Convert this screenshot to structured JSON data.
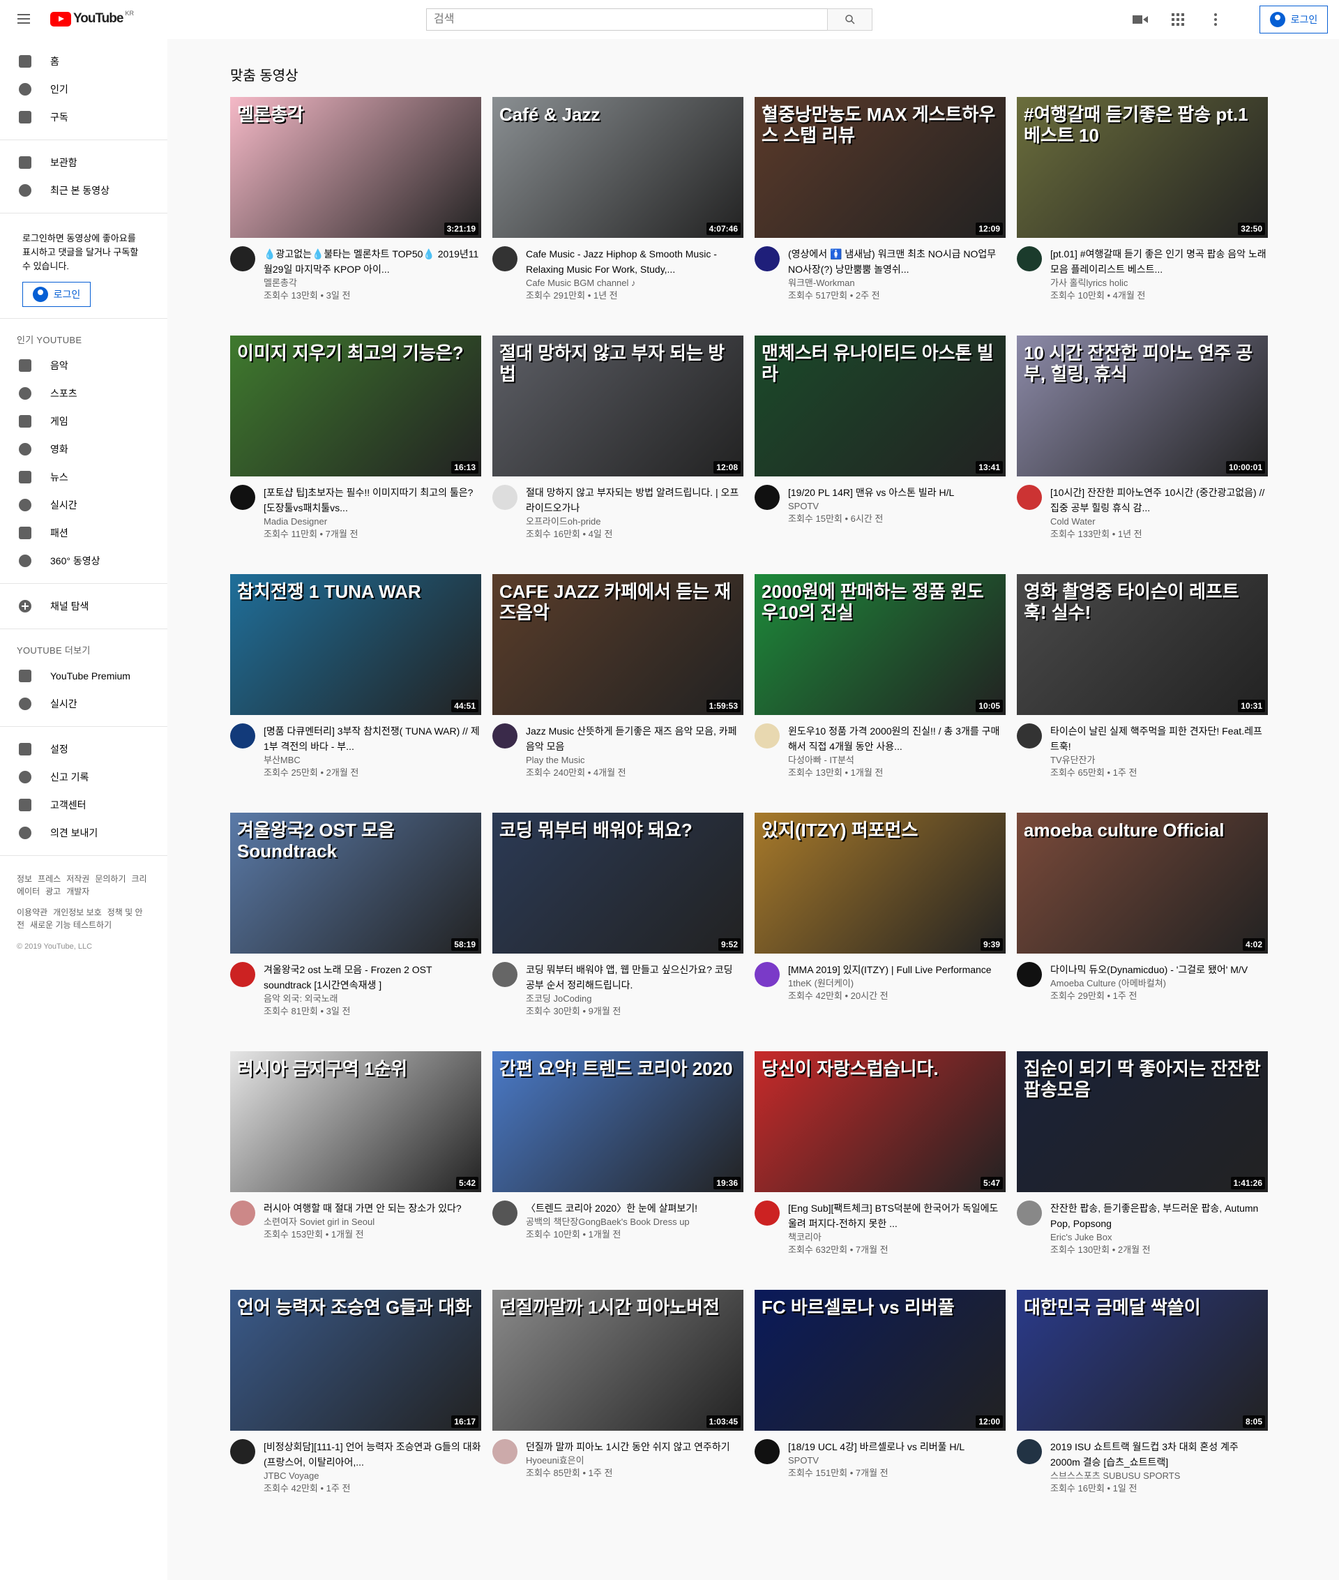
{
  "header": {
    "logo_text": "YouTube",
    "logo_region": "KR",
    "search_placeholder": "검색",
    "signin": "로그인",
    "icons": [
      "menu-icon",
      "video-camera-icon",
      "apps-icon",
      "more-vert-icon"
    ]
  },
  "sidebar": {
    "primary": [
      {
        "label": "홈",
        "icon": "home-icon"
      },
      {
        "label": "인기",
        "icon": "flame-icon"
      },
      {
        "label": "구독",
        "icon": "subscriptions-icon"
      }
    ],
    "library": [
      {
        "label": "보관함",
        "icon": "folder-icon"
      },
      {
        "label": "최근 본 동영상",
        "icon": "history-icon"
      }
    ],
    "note": "로그인하면 동영상에 좋아요를 표시하고 댓글을 달거나 구독할 수 있습니다.",
    "login": "로그인",
    "popular_title": "인기 YOUTUBE",
    "popular": [
      {
        "label": "음악",
        "icon": "music-icon"
      },
      {
        "label": "스포츠",
        "icon": "sports-icon"
      },
      {
        "label": "게임",
        "icon": "gaming-icon"
      },
      {
        "label": "영화",
        "icon": "movies-icon"
      },
      {
        "label": "뉴스",
        "icon": "news-icon"
      },
      {
        "label": "실시간",
        "icon": "live-icon"
      },
      {
        "label": "패션",
        "icon": "fashion-icon"
      },
      {
        "label": "360° 동영상",
        "icon": "vr-icon"
      }
    ],
    "browse": "채널 탐색",
    "more_title": "YOUTUBE 더보기",
    "more": [
      {
        "label": "YouTube Premium",
        "icon": "premium-icon"
      },
      {
        "label": "실시간",
        "icon": "broadcast-icon"
      }
    ],
    "settings": [
      {
        "label": "설정",
        "icon": "settings-icon"
      },
      {
        "label": "신고 기록",
        "icon": "flag-icon"
      },
      {
        "label": "고객센터",
        "icon": "help-icon"
      },
      {
        "label": "의견 보내기",
        "icon": "feedback-icon"
      }
    ],
    "footer1": [
      "정보",
      "프레스",
      "저작권",
      "문의하기",
      "크리에이터",
      "광고",
      "개발자"
    ],
    "footer2": [
      "이용약관",
      "개인정보 보호",
      "정책 및 안전",
      "새로운 기능 테스트하기"
    ],
    "copyright": "© 2019 YouTube, LLC"
  },
  "main": {
    "section_title": "맞춤 동영상"
  },
  "videos": [
    {
      "title": "💧광고없는💧불타는 멜론차트 TOP50💧 2019년11월29일 마지막주 KPOP 아이...",
      "channel": "멜론총각",
      "views": "조회수 13만회 • 3일 전",
      "duration": "3:21:19",
      "overlay": "멜론총각",
      "bg": "#f5b9c7",
      "av": "#222"
    },
    {
      "title": "Cafe Music - Jazz Hiphop & Smooth Music - Relaxing Music For Work, Study,...",
      "channel": "Cafe Music BGM channel ♪",
      "views": "조회수 291만회 • 1년 전",
      "duration": "4:07:46",
      "overlay": "Café & Jazz",
      "bg": "#8a8f92",
      "av": "#333"
    },
    {
      "title": "(영상에서 🚺 냄새남) 워크맨 최초 NO시급 NO업무 NO사장(?) 낭만뿜뿜 놀영쉬...",
      "channel": "워크맨-Workman",
      "views": "조회수 517만회 • 2주 전",
      "duration": "12:09",
      "overlay": "혈중낭만농도 MAX 게스트하우스 스탭 리뷰",
      "bg": "#5b3a2a",
      "av": "#1f1f7a"
    },
    {
      "title": "[pt.01] #여행갈때 듣기 좋은 인기 명곡 팝송 음악 노래 모음 플레이리스트 베스트...",
      "channel": "가사 홀릭lyrics holic",
      "views": "조회수 10만회 • 4개월 전",
      "duration": "32:50",
      "overlay": "#여행갈때 듣기좋은 팝송 pt.1 베스트 10",
      "bg": "#6b6e3c",
      "av": "#1b3b2c"
    },
    {
      "title": "[포토샵 팁]초보자는 필수!! 이미지따기 최고의 툴은? [도장툴vs패치툴vs...",
      "channel": "Madia Designer",
      "views": "조회수 11만회 • 7개월 전",
      "duration": "16:13",
      "overlay": "이미지 지우기 최고의 기능은?",
      "bg": "#3f7a2e",
      "av": "#111"
    },
    {
      "title": "절대 망하지 않고 부자되는 방법 알려드립니다. | 오프라이드오가나",
      "channel": "오프라이드oh-pride",
      "views": "조회수 16만회 • 4일 전",
      "duration": "12:08",
      "overlay": "절대 망하지 않고 부자 되는 방법",
      "bg": "#5d5f66",
      "av": "#ddd"
    },
    {
      "title": "[19/20 PL 14R] 맨유 vs 아스톤 빌라 H/L",
      "channel": "SPOTV",
      "views": "조회수 15만회 • 6시간 전",
      "duration": "13:41",
      "overlay": "맨체스터 유나이티드 아스톤 빌라",
      "bg": "#1b4a2a",
      "av": "#111"
    },
    {
      "title": "[10시간] 잔잔한 피아노연주 10시간 (중간광고없음) // 집중 공부 힐링 휴식 감...",
      "channel": "Cold Water",
      "views": "조회수 133만회 • 1년 전",
      "duration": "10:00:01",
      "overlay": "10 시간 잔잔한 피아노 연주 공부, 힐링, 휴식",
      "bg": "#8c8aa8",
      "av": "#c33"
    },
    {
      "title": "[명품 다큐멘터리] 3부작 참치전쟁( TUNA WAR) // 제1부 격전의 바다 - 부...",
      "channel": "부산MBC",
      "views": "조회수 25만회 • 2개월 전",
      "duration": "44:51",
      "overlay": "참치전쟁 1 TUNA WAR",
      "bg": "#1f6f9a",
      "av": "#123a7a"
    },
    {
      "title": "Jazz Music 산뜻하게 듣기좋은 재즈 음악 모음, 카페음악 모음",
      "channel": "Play the Music",
      "views": "조회수 240만회 • 4개월 전",
      "duration": "1:59:53",
      "overlay": "CAFE JAZZ 카페에서 듣는 재즈음악",
      "bg": "#5a3d2a",
      "av": "#3a2a4a"
    },
    {
      "title": "윈도우10 정품 가격 2000원의 진실!! / 총 3개를 구매해서 직접 4개월 동안 사용...",
      "channel": "다성아빠 - IT분석",
      "views": "조회수 13만회 • 1개월 전",
      "duration": "10:05",
      "overlay": "2000원에 판매하는 정품 윈도우10의 진실",
      "bg": "#1d8a3a",
      "av": "#e8d8b0"
    },
    {
      "title": "타이슨이 날린 실제 핵주먹을 피한 견자단! Feat.레프트훅!",
      "channel": "TV유단잔가",
      "views": "조회수 65만회 • 1주 전",
      "duration": "10:31",
      "overlay": "영화 촬영중 타이슨이 레프트훅! 실수!",
      "bg": "#4a4a4a",
      "av": "#333"
    },
    {
      "title": "겨울왕국2 ost 노래 모음 - Frozen 2 OST soundtrack [1시간연속재생 ]",
      "channel": "음악 외국: 외국노래",
      "views": "조회수 81만회 • 3일 전",
      "duration": "58:19",
      "overlay": "겨울왕국2 OST 모음 Soundtrack",
      "bg": "#5a7aa8",
      "av": "#c22"
    },
    {
      "title": "코딩 뭐부터 배워야 앱, 웹 만들고 싶으신가요? 코딩 공부 순서 정리해드립니다.",
      "channel": "조코딩 JoCoding",
      "views": "조회수 30만회 • 9개월 전",
      "duration": "9:52",
      "overlay": "코딩 뭐부터 배워야 돼요?",
      "bg": "#2b3a55",
      "av": "#666"
    },
    {
      "title": "[MMA 2019] 있지(ITZY) | Full Live Performance",
      "channel": "1theK (원더케이)",
      "views": "조회수 42만회 • 20시간 전",
      "duration": "9:39",
      "overlay": "있지(ITZY) 퍼포먼스",
      "bg": "#a87a2a",
      "av": "#7a3ac8"
    },
    {
      "title": "다이나믹 듀오(Dynamicduo) - '그걸로 됐어' M/V",
      "channel": "Amoeba Culture (아메바컬쳐)",
      "views": "조회수 29만회 • 1주 전",
      "duration": "4:02",
      "overlay": "amoeba culture Official",
      "bg": "#7a4a3a",
      "av": "#111"
    },
    {
      "title": "러시아 여행할 때 절대 가면 안 되는 장소가 있다?",
      "channel": "소련여자 Soviet girl in Seoul",
      "views": "조회수 153만회 • 1개월 전",
      "duration": "5:42",
      "overlay": "러시아 금지구역 1순위",
      "bg": "#e6e6e6",
      "av": "#c88"
    },
    {
      "title": "〈트렌드 코리아 2020〉한 눈에 살펴보기!",
      "channel": "공백의 책단장GongBaek's Book Dress up",
      "views": "조회수 10만회 • 1개월 전",
      "duration": "19:36",
      "overlay": "간편 요약! 트렌드 코리아 2020",
      "bg": "#4a7ac8",
      "av": "#555"
    },
    {
      "title": "[Eng Sub][팩트체크] BTS덕분에 한국어가 독일에도 울려 퍼지다-전하지 못한 ...",
      "channel": "책코리아",
      "views": "조회수 632만회 • 7개월 전",
      "duration": "5:47",
      "overlay": "당신이 자랑스럽습니다.",
      "bg": "#c82a2a",
      "av": "#c22"
    },
    {
      "title": "잔잔한 팝송, 듣기좋은팝송, 부드러운 팝송, Autumn Pop, Popsong",
      "channel": "Eric's Juke Box",
      "views": "조회수 130만회 • 2개월 전",
      "duration": "1:41:26",
      "overlay": "집순이 되기 딱 좋아지는 잔잔한 팝송모음",
      "bg": "#1a2238",
      "av": "#888"
    },
    {
      "title": "[비정상회담][111-1] 언어 능력자 조승연과 G들의 대화(프랑스어, 이탈리아어,...",
      "channel": "JTBC Voyage",
      "views": "조회수 42만회 • 1주 전",
      "duration": "16:17",
      "overlay": "언어 능력자 조승연 G들과 대화",
      "bg": "#3a5a8a",
      "av": "#222"
    },
    {
      "title": "던질까 말까 피아노 1시간 동안 쉬지 않고 연주하기",
      "channel": "Hyoeuni효은이",
      "views": "조회수 85만회 • 1주 전",
      "duration": "1:03:45",
      "overlay": "던질까말까 1시간 피아노버전",
      "bg": "#8a8a8a",
      "av": "#caa"
    },
    {
      "title": "[18/19 UCL 4강] 바르셀로나 vs 리버풀 H/L",
      "channel": "SPOTV",
      "views": "조회수 151만회 • 7개월 전",
      "duration": "12:00",
      "overlay": "FC 바르셀로나 vs 리버풀",
      "bg": "#0a1a5a",
      "av": "#111"
    },
    {
      "title": "2019 ISU 쇼트트랙 월드컵 3차 대회 혼성 계주 2000m 결승 [습츠_쇼트트랙]",
      "channel": "스브스스포츠 SUBUSU SPORTS",
      "views": "조회수 16만회 • 1일 전",
      "duration": "8:05",
      "overlay": "대한민국 금메달 싹쓸이",
      "bg": "#2a3a8a",
      "av": "#234"
    }
  ]
}
